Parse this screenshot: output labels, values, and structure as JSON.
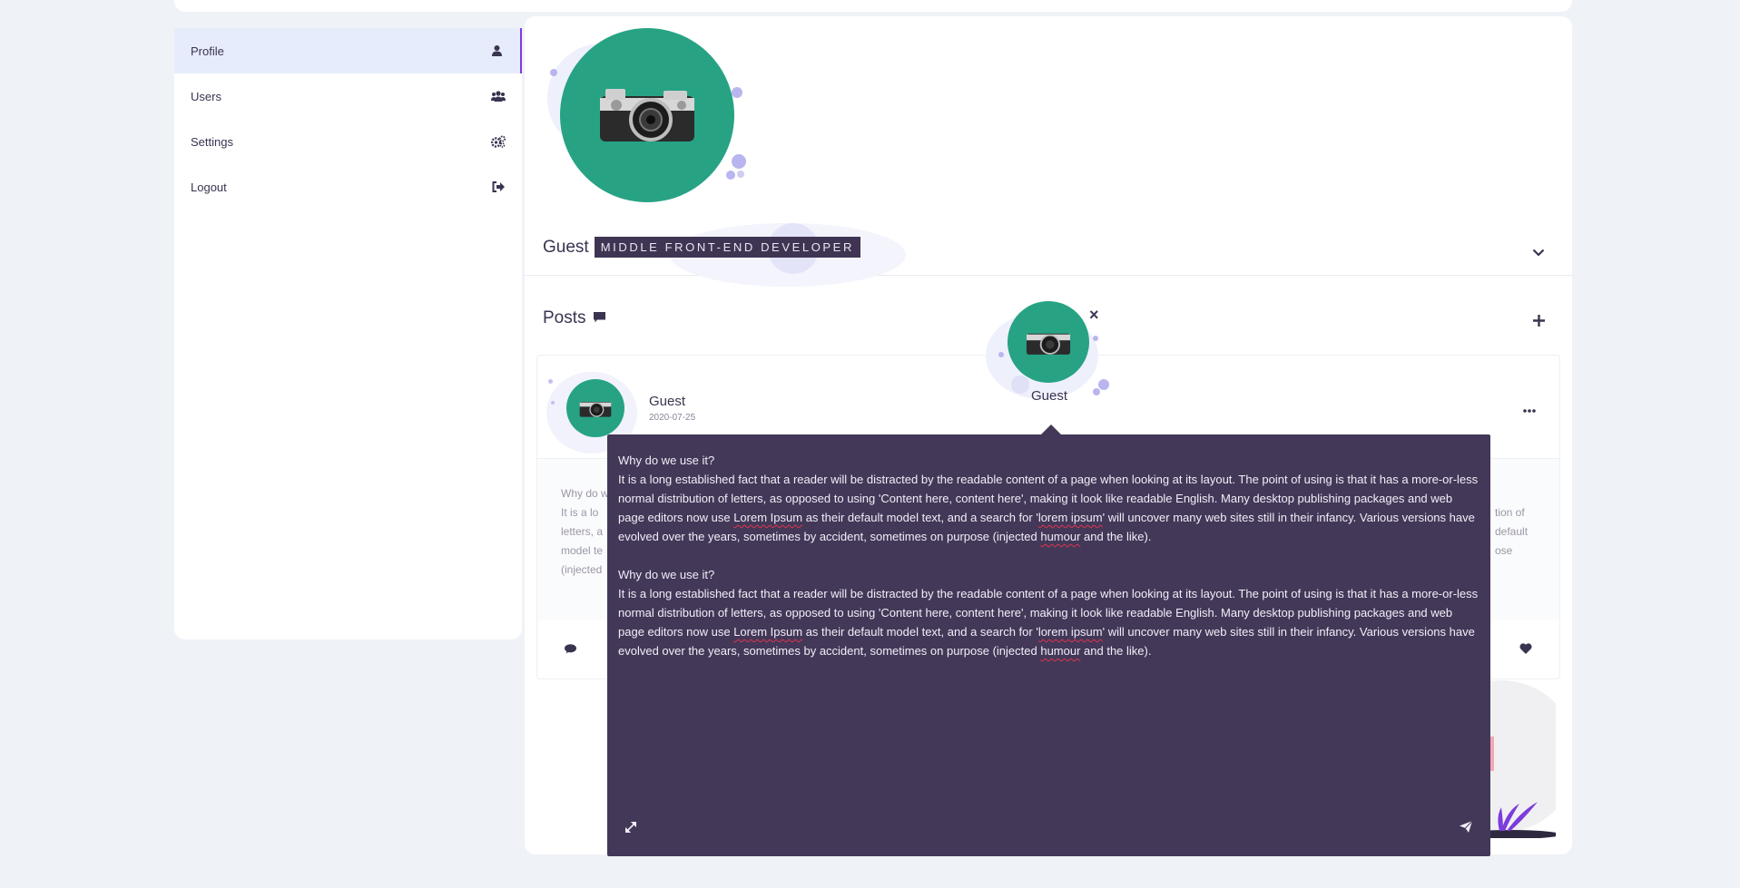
{
  "nav": [
    {
      "label": "Profile",
      "icon": "user-icon",
      "active": true
    },
    {
      "label": "Users",
      "icon": "users-icon",
      "active": false
    },
    {
      "label": "Settings",
      "icon": "gears-icon",
      "active": false
    },
    {
      "label": "Logout",
      "icon": "logout-icon",
      "active": false
    }
  ],
  "profile": {
    "name": "Guest",
    "role": "MIDDLE FRONT-END DEVELOPER"
  },
  "posts": {
    "title": "Posts",
    "items": [
      {
        "author": "Guest",
        "date": "2020-07-25",
        "body_lines": [
          "Why do w",
          "It is a lo",
          "letters, a",
          "model te",
          "(injected"
        ],
        "body_right_lines": [
          "",
          "tion of",
          "default",
          "ose"
        ]
      }
    ]
  },
  "popup": {
    "author": "Guest",
    "paragraphs": [
      {
        "heading": "Why do we use it?",
        "pre1": "It is a long established fact that a reader will be distracted by the readable content of a page when looking at its layout. The point of using is that it has a more-or-less normal distribution of letters, as opposed to using 'Content here, content here', making it look like readable English. Many desktop publishing packages and web page editors now use ",
        "mark1": "Lorem Ipsum",
        "mid1": " as their default model text, and a search for '",
        "mark2": "lorem ipsum",
        "mid2": "' will uncover many web sites still in their infancy. Various versions have evolved over the years, sometimes by accident, sometimes on purpose (injected ",
        "mark3": "humour",
        "post": " and the like)."
      },
      {
        "heading": "Why do we use it?",
        "pre1": "It is a long established fact that a reader will be distracted by the readable content of a page when looking at its layout. The point of using is that it has a more-or-less normal distribution of letters, as opposed to using 'Content here, content here', making it look like readable English. Many desktop publishing packages and web page editors now use ",
        "mark1": "Lorem Ipsum",
        "mid1": " as their default model text, and a search for '",
        "mark2": "lorem ipsum",
        "mid2": "' will uncover many web sites still in their infancy. Various versions have evolved over the years, sometimes by accident, sometimes on purpose (injected ",
        "mark3": "humour",
        "post": " and the like)."
      }
    ]
  },
  "colors": {
    "accent": "#7d3cdc",
    "avatar_bg": "#27a384",
    "popup_bg": "#433858",
    "badge_bg": "#3f3553"
  }
}
